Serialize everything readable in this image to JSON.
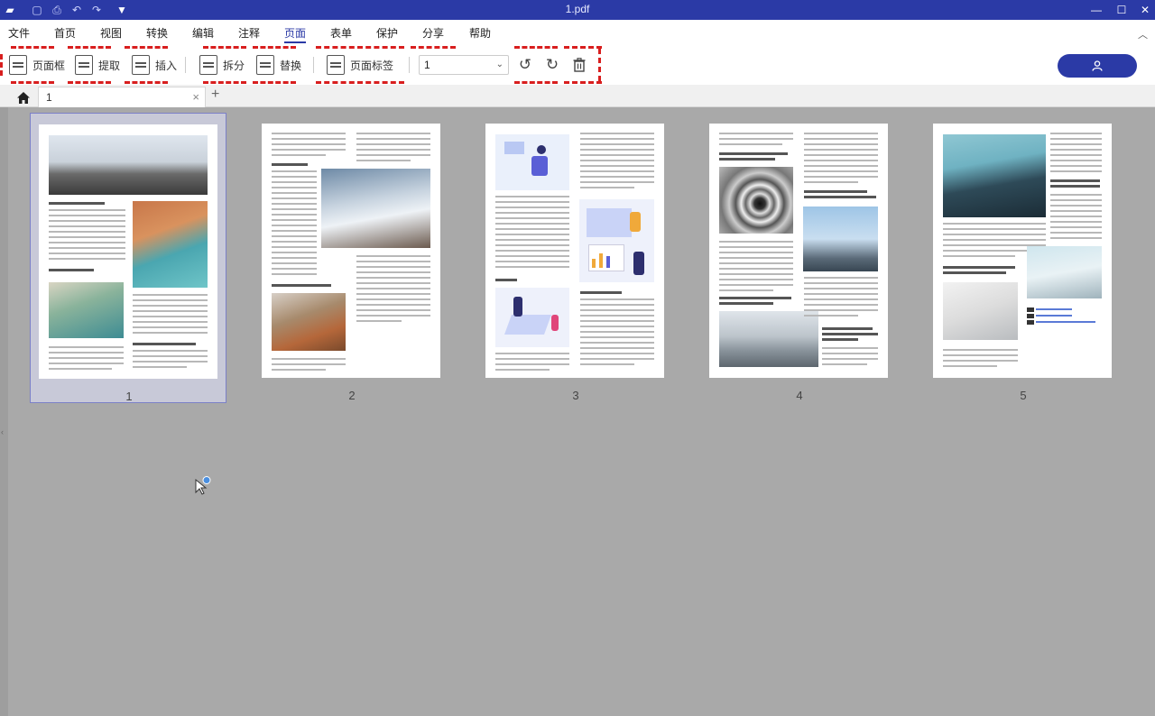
{
  "app": {
    "title": "1.pdf",
    "quick_access_icons": [
      "app-logo-icon",
      "save-icon",
      "print-icon",
      "undo-icon",
      "redo-icon",
      "customize-icon"
    ]
  },
  "menu": {
    "items": [
      "文件",
      "首页",
      "视图",
      "转换",
      "编辑",
      "注释",
      "页面",
      "表单",
      "保护",
      "分享",
      "帮助"
    ],
    "active": "页面"
  },
  "toolbar": {
    "crop_label": "页面框",
    "extract_label": "提取",
    "insert_label": "插入",
    "split_label": "拆分",
    "replace_label": "替换",
    "page_label_label": "页面标签",
    "page_select_value": "1"
  },
  "tabs": {
    "doc_tab_label": "1"
  },
  "pages": [
    {
      "number": "1"
    },
    {
      "number": "2"
    },
    {
      "number": "3"
    },
    {
      "number": "4"
    },
    {
      "number": "5"
    }
  ],
  "colors": {
    "accent": "#2b3aa6",
    "highlight_dash": "#d81e1e",
    "workspace": "#a9a9a9"
  }
}
